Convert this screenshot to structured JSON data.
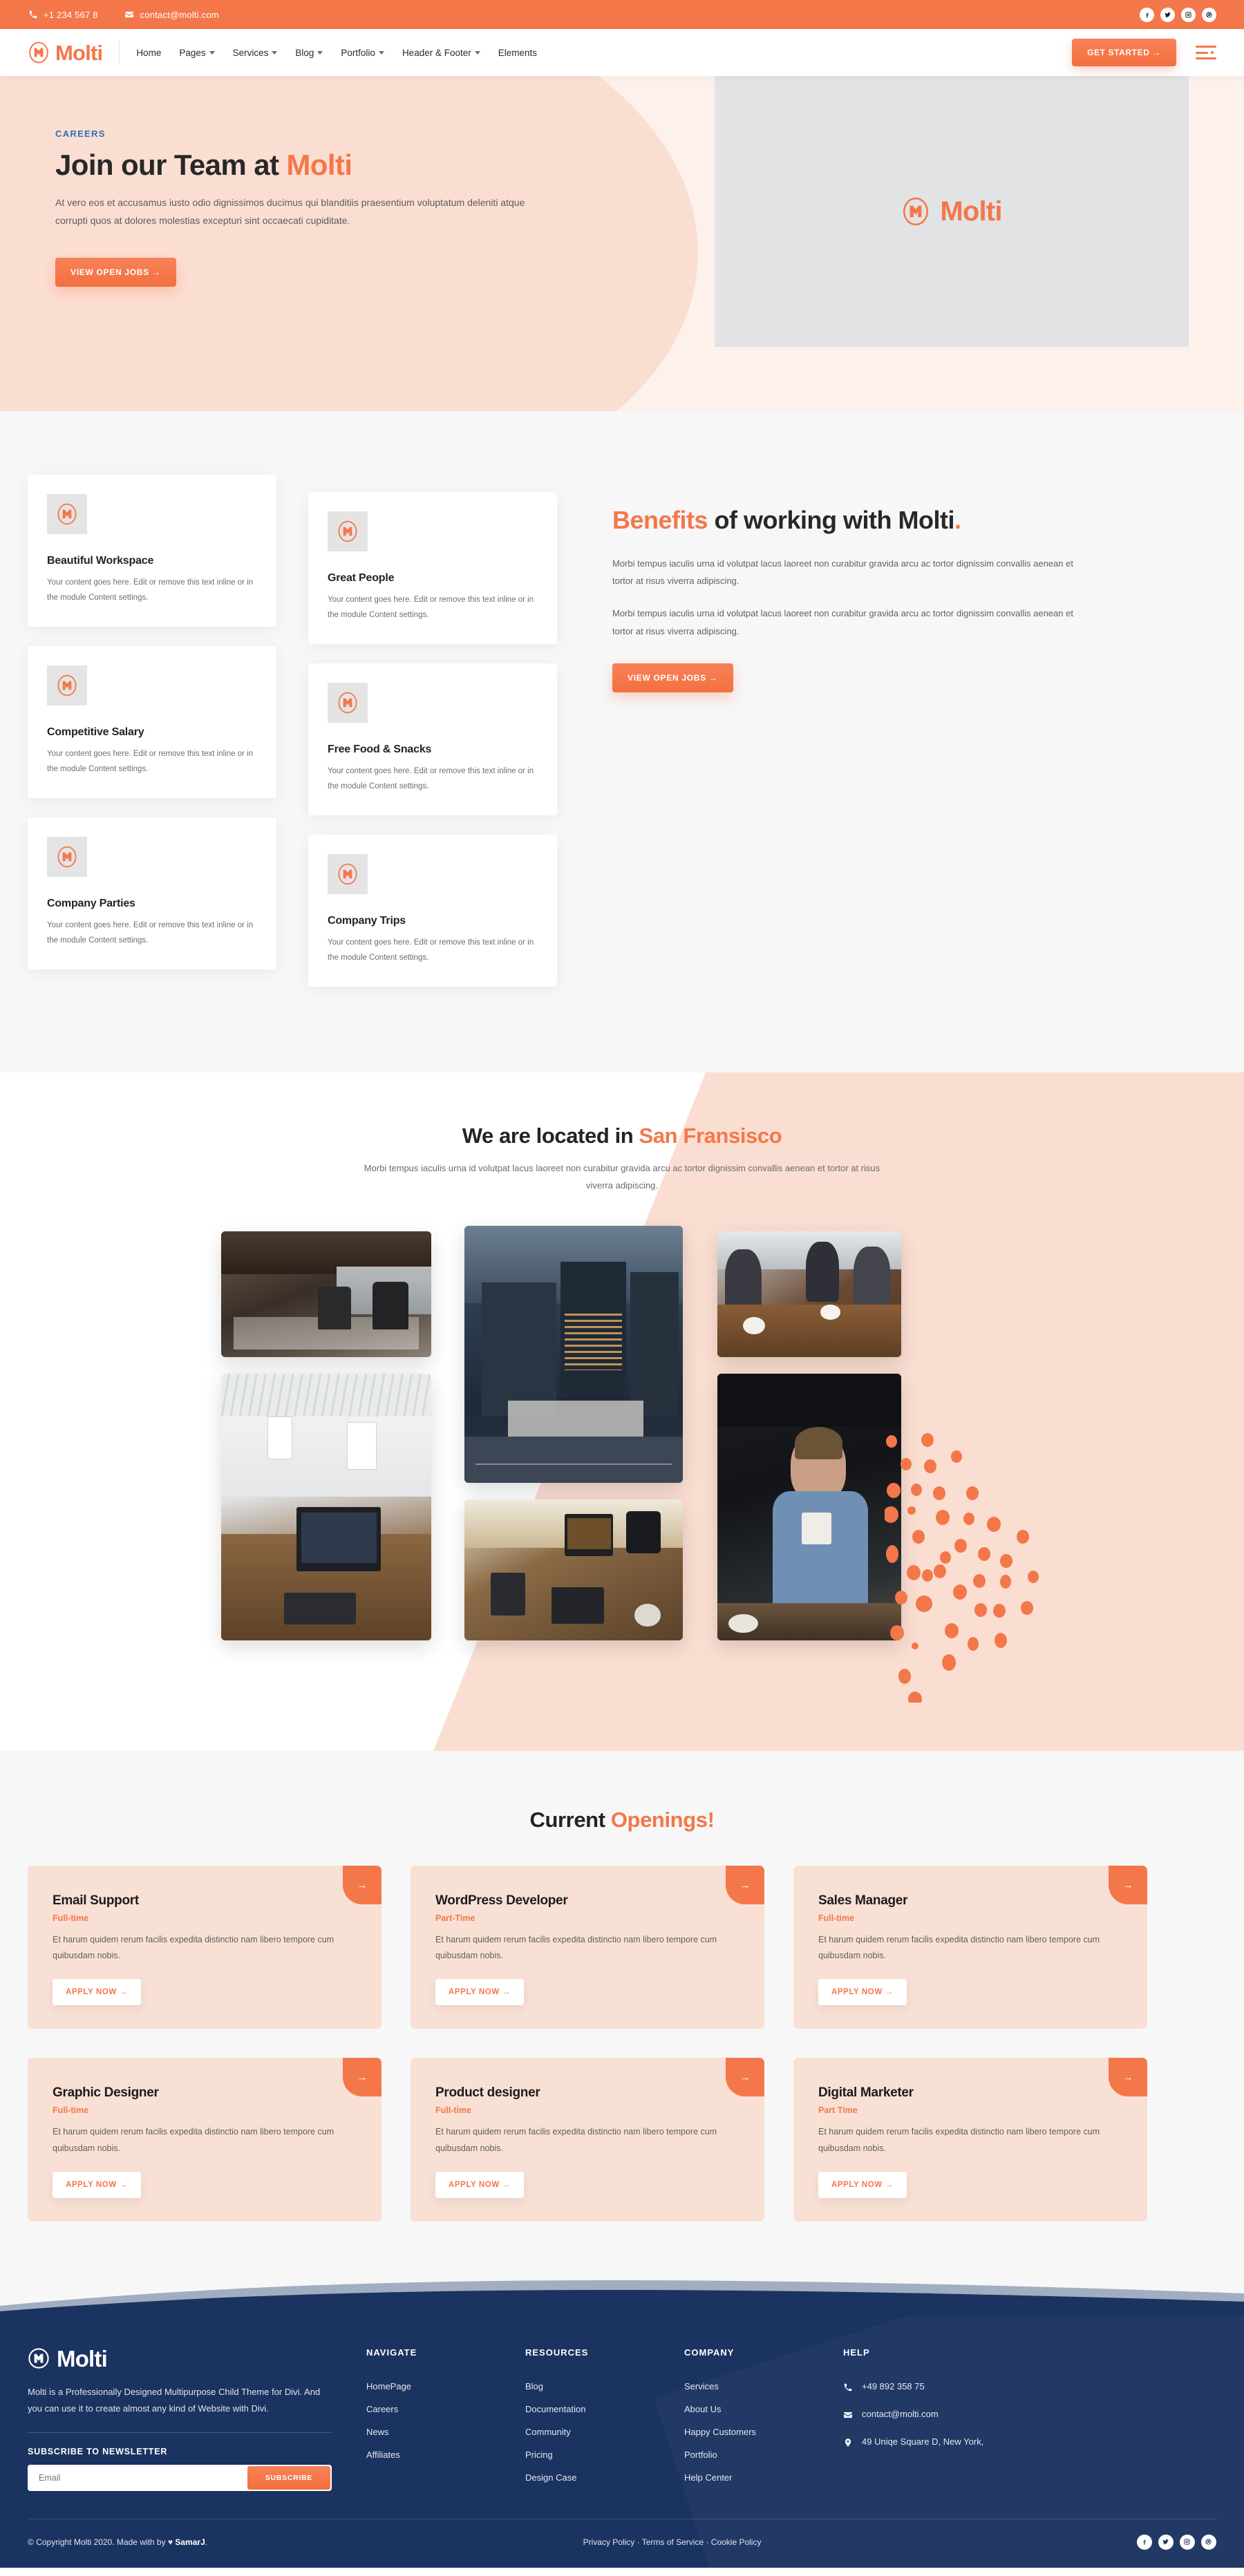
{
  "brand": {
    "name": "Molti",
    "logo_icon": "molti-circle-m-logo"
  },
  "topbar": {
    "phone": "+1 234 567 8",
    "email": "contact@molti.com",
    "phone_icon": "phone-icon",
    "mail_icon": "mail-icon",
    "social": [
      "facebook-icon",
      "twitter-icon",
      "instagram-icon",
      "dribbble-icon"
    ]
  },
  "nav": {
    "items": [
      {
        "label": "Home",
        "has_dropdown": false
      },
      {
        "label": "Pages",
        "has_dropdown": true
      },
      {
        "label": "Services",
        "has_dropdown": true
      },
      {
        "label": "Blog",
        "has_dropdown": true
      },
      {
        "label": "Portfolio",
        "has_dropdown": true
      },
      {
        "label": "Header & Footer",
        "has_dropdown": true
      },
      {
        "label": "Elements",
        "has_dropdown": false
      }
    ],
    "cta_label": "GET STARTED →",
    "menu_icon": "hamburger-menu-icon"
  },
  "hero": {
    "eyebrow": "CAREERS",
    "title_plain": "Join our Team at ",
    "title_accent": "Molti",
    "paragraph": "At vero eos et accusamus iusto odio dignissimos ducimus qui blanditiis praesentium voluptatum deleniti atque corrupti quos at dolores molestias excepturi sint occaecati cupiditate.",
    "cta_label": "VIEW OPEN JOBS →",
    "image_logo_text": "Molti"
  },
  "benefits": {
    "title_accent": "Benefits",
    "title_plain": " of working with Molti",
    "title_dot": ".",
    "paragraph_1": "Morbi tempus iaculis urna id volutpat lacus laoreet non curabitur gravida arcu ac tortor dignissim convallis aenean et tortor at risus viverra adipiscing.",
    "paragraph_2": "Morbi tempus iaculis urna id volutpat lacus laoreet non curabitur gravida arcu ac tortor dignissim convallis aenean et tortor at risus viverra adipiscing.",
    "cta_label": "VIEW OPEN JOBS →",
    "card_body": "Your content goes here. Edit or remove this text inline or in the module Content settings.",
    "cards_left": [
      {
        "title": "Beautiful Workspace",
        "body": "Your content goes here. Edit or remove this text inline or in the module Content settings."
      },
      {
        "title": "Competitive Salary",
        "body": "Your content goes here. Edit or remove this text inline or in the module Content settings."
      },
      {
        "title": "Company Parties",
        "body": "Your content goes here. Edit or remove this text inline or in the module Content settings."
      }
    ],
    "cards_right": [
      {
        "title": "Great People",
        "body": "Your content goes here. Edit or remove this text inline or in the module Content settings."
      },
      {
        "title": "Free Food & Snacks",
        "body": "Your content goes here. Edit or remove this text inline or in the module Content settings."
      },
      {
        "title": "Company Trips",
        "body": "Your content goes here. Edit or remove this text inline or in the module Content settings."
      }
    ]
  },
  "location": {
    "title_plain": "We are located in ",
    "title_accent": "San Fransisco",
    "paragraph": "Morbi tempus iaculis urna id volutpat lacus laoreet non curabitur gravida arcu ac tortor dignissim convallis aenean et tortor at risus viverra adipiscing.",
    "gallery": [
      {
        "name": "open-office-interior"
      },
      {
        "name": "city-office-building-dusk"
      },
      {
        "name": "business-meeting-table"
      },
      {
        "name": "bright-loft-workspace-desk"
      },
      {
        "name": "desk-with-laptop-tablet-topdown"
      },
      {
        "name": "woman-holding-coffee-cup"
      }
    ]
  },
  "openings": {
    "title_plain": "Current ",
    "title_accent": "Openings!",
    "apply_label": "APPLY NOW →",
    "arrow_icon": "arrow-right-icon",
    "jobs": [
      {
        "title": "Email Support",
        "type": "Full-time",
        "desc": "Et harum quidem rerum facilis expedita distinctio nam libero tempore cum quibusdam nobis."
      },
      {
        "title": "WordPress Developer",
        "type": "Part-Time",
        "desc": "Et harum quidem rerum facilis expedita distinctio nam libero tempore cum quibusdam nobis."
      },
      {
        "title": "Sales Manager",
        "type": "Full-time",
        "desc": "Et harum quidem rerum facilis expedita distinctio nam libero tempore cum quibusdam nobis."
      },
      {
        "title": "Graphic Designer",
        "type": "Full-time",
        "desc": "Et harum quidem rerum facilis expedita distinctio nam libero tempore cum quibusdam nobis."
      },
      {
        "title": "Product designer",
        "type": "Full-time",
        "desc": "Et harum quidem rerum facilis expedita distinctio nam libero tempore cum quibusdam nobis."
      },
      {
        "title": "Digital Marketer",
        "type": "Part Time",
        "desc": "Et harum quidem rerum facilis expedita distinctio nam libero tempore cum quibusdam nobis."
      }
    ]
  },
  "footer": {
    "description": "Molti is a Professionally Designed  Multipurpose Child Theme for Divi. And you can use it to create almost any kind of Website with Divi.",
    "subscribe_label": "SUBSCRIBE TO NEWSLETTER",
    "email_placeholder": "Email",
    "email_value": "",
    "subscribe_button": "SUBSCRIBE",
    "columns": [
      {
        "heading": "NAVIGATE",
        "links": [
          "HomePage",
          "Careers",
          "News",
          "Affiliates"
        ]
      },
      {
        "heading": "RESOURCES",
        "links": [
          "Blog",
          "Documentation",
          "Community",
          "Pricing",
          "Design Case"
        ]
      },
      {
        "heading": "COMPANY",
        "links": [
          "Services",
          "About Us",
          "Happy Customers",
          "Portfolio",
          "Help Center"
        ]
      }
    ],
    "help": {
      "heading": "HELP",
      "phone": "+49 892 358 75",
      "email": "contact@molti.com",
      "address": "49 Uniqe Square D, New York,"
    },
    "copyright_prefix": "© Copyright Molti 2020. Made with by ",
    "copyright_author": "SamarJ",
    "copyright_suffix": ".",
    "legal": "Privacy Policy · Terms of Service · Cookie Policy",
    "social": [
      "facebook-icon",
      "twitter-icon",
      "instagram-icon",
      "dribbble-icon"
    ]
  },
  "colors": {
    "accent": "#F4774A",
    "navy": "#1B3360",
    "peach": "#FBDED2",
    "card_peach": "#F9E0D4",
    "eyebrow_blue": "#2F6FB5"
  }
}
